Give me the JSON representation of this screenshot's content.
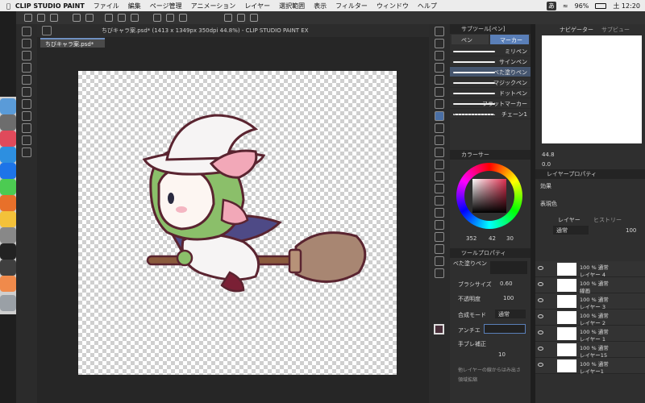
{
  "menubar": {
    "app": "CLIP STUDIO PAINT",
    "items": [
      "ファイル",
      "編集",
      "ページ管理",
      "アニメーション",
      "レイヤー",
      "選択範囲",
      "表示",
      "フィルター",
      "ウィンドウ",
      "ヘルプ"
    ],
    "battery": "96%",
    "clock": "土 12:20",
    "input_mode": "あ"
  },
  "document": {
    "tab": "ちびキャラ案.psd*",
    "title": "ちびキャラ案.psd* (1413 x 1349px 350dpi 44.8%) - CLIP STUDIO PAINT EX"
  },
  "subtool": {
    "header": "サブツール[ペン]",
    "tabs": [
      "ペン",
      "マーカー"
    ],
    "brushes": [
      "ミリペン",
      "サインペン",
      "べた塗りペン",
      "マジックペン",
      "ドットペン",
      "フラットマーカー",
      "チェーン1"
    ],
    "selected": "べた塗りペン"
  },
  "color": {
    "header": "カラーサー",
    "hsv": [
      "352",
      "42",
      "30"
    ]
  },
  "tool_property": {
    "header": "ツールプロパティ",
    "brush_name": "べた塗りペン",
    "brush_size_label": "ブラシサイズ",
    "brush_size_value": "0.60",
    "opacity_label": "不透明度",
    "opacity_value": "100",
    "blend_label": "合成モード",
    "blend_value": "通常",
    "antialias_label": "アンチエ",
    "stabilization_label": "手ブレ補正",
    "stabilization_value": "10",
    "reference_label": "他レイヤーの線からはみ出さ",
    "area_label": "領域拡縮"
  },
  "navigator": {
    "tabs": [
      "ナビゲーター",
      "サブビュー"
    ],
    "zoom": "44.8",
    "angle": "0.0"
  },
  "layer_property": {
    "header": "レイヤープロパティ",
    "effect_label": "効果",
    "color_label": "表現色"
  },
  "layers": {
    "tabs": [
      "レイヤー",
      "ヒストリー"
    ],
    "blend": "通常",
    "opacity": "100",
    "items": [
      {
        "line1": "100 % 通常",
        "line2": "レイヤー 4"
      },
      {
        "line1": "100 % 通常",
        "line2": "線画"
      },
      {
        "line1": "100 % 通常",
        "line2": "レイヤー 3"
      },
      {
        "line1": "100 % 通常",
        "line2": "レイヤー 2"
      },
      {
        "line1": "100 % 通常",
        "line2": "レイヤー 1"
      },
      {
        "line1": "100 % 通常",
        "line2": "レイヤー15"
      },
      {
        "line1": "100 % 通常",
        "line2": "レイヤー1"
      }
    ]
  },
  "colors": {
    "background": "#1e1e1e",
    "panel": "#2f2f2f",
    "accent": "#4a6fa5",
    "sketch_outline": "#5a2430"
  }
}
